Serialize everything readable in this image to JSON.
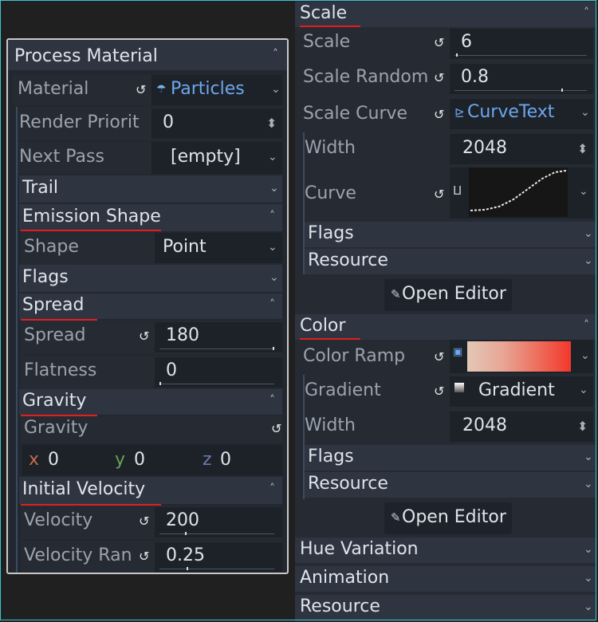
{
  "left": {
    "header": "Process Material",
    "material_label": "Material",
    "material_value": "Particles",
    "render_priority_label": "Render Priorit",
    "render_priority_value": "0",
    "next_pass_label": "Next Pass",
    "next_pass_value": "[empty]",
    "trail_label": "Trail",
    "emission_shape_label": "Emission Shape",
    "shape_label": "Shape",
    "shape_value": "Point",
    "flags_label": "Flags",
    "spread_section": "Spread",
    "spread_label": "Spread",
    "spread_value": "180",
    "flatness_label": "Flatness",
    "flatness_value": "0",
    "gravity_section": "Gravity",
    "gravity_label": "Gravity",
    "gravity_x_axis": "x",
    "gravity_x": "0",
    "gravity_y_axis": "y",
    "gravity_y": "0",
    "gravity_z_axis": "z",
    "gravity_z": "0",
    "initial_velocity_section": "Initial Velocity",
    "velocity_label": "Velocity",
    "velocity_value": "200",
    "velocity_random_label": "Velocity Ran",
    "velocity_random_value": "0.25"
  },
  "right": {
    "scale_section": "Scale",
    "scale_label": "Scale",
    "scale_value": "6",
    "scale_random_label": "Scale Random",
    "scale_random_value": "0.8",
    "scale_curve_label": "Scale Curve",
    "scale_curve_value": "CurveText",
    "width_label": "Width",
    "width_value": "2048",
    "curve_label": "Curve",
    "flags_label": "Flags",
    "resource_label": "Resource",
    "open_editor_label": "Open Editor",
    "color_section": "Color",
    "color_ramp_label": "Color Ramp",
    "gradient_label": "Gradient",
    "gradient_value": "Gradient",
    "width2_label": "Width",
    "width2_value": "2048",
    "flags2_label": "Flags",
    "resource2_label": "Resource",
    "open_editor2_label": "Open Editor",
    "hue_variation_label": "Hue Variation",
    "animation_label": "Animation",
    "resource3_label": "Resource"
  },
  "icons": {
    "revert": "↺",
    "chevron_down": "⌄",
    "chevron_up": "˄",
    "spinner": "⬍",
    "edit": "✎"
  },
  "colors": {
    "accent_red": "#e21f1f",
    "link_blue": "#6da7ee",
    "frame_cyan": "#39c6d3",
    "ramp_start": "#e2c8b6",
    "ramp_end": "#f2372b"
  }
}
